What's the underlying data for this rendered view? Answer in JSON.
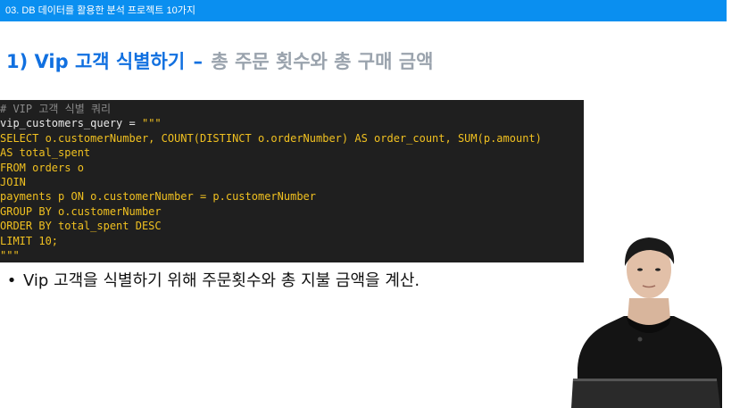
{
  "header": {
    "section": "03. DB 데이터를 활용한 분석 프로젝트 10가지"
  },
  "title": {
    "main": "1) Vip 고객 식별하기",
    "separator": "–",
    "sub": "총 주문 횟수와 총 구매 금액"
  },
  "code": {
    "comment": "# VIP 고객 식별 쿼리",
    "var_name": "vip_customers_query",
    "assign": " = ",
    "open_quote": "\"\"\"",
    "lines": [
      "SELECT o.customerNumber, COUNT(DISTINCT o.orderNumber) AS order_count, SUM(p.amount)",
      "AS total_spent",
      "FROM orders o",
      "JOIN",
      "payments p ON o.customerNumber = p.customerNumber",
      "GROUP BY o.customerNumber",
      "ORDER BY total_spent DESC",
      "LIMIT 10;",
      "\"\"\""
    ]
  },
  "bullet": {
    "marker": "•",
    "text": "Vip 고객을 식별하기 위해 주문횟수와 총 지불 금액을 계산."
  },
  "colors": {
    "header_bg": "#0a8ff0",
    "title": "#1170e0",
    "subtitle": "#9aa3ad",
    "code_bg": "#1f1f1f",
    "code_string": "#f0c020"
  }
}
